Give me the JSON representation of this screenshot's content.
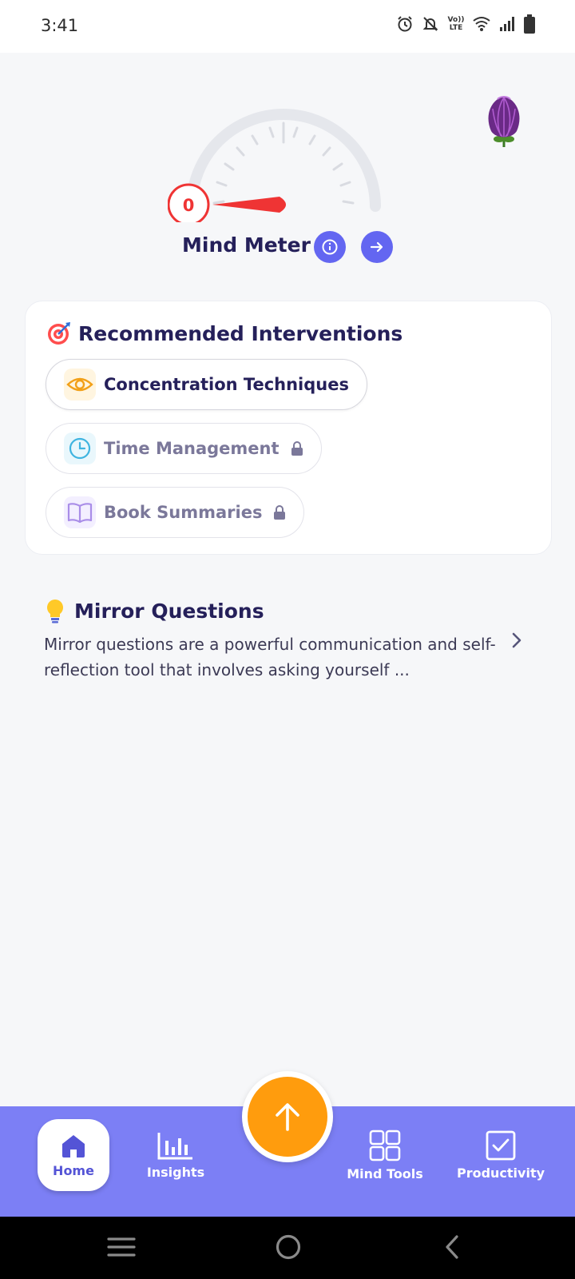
{
  "status_bar": {
    "time": "3:41",
    "icons": [
      "alarm-icon",
      "bell-muted-icon",
      "volte-icon",
      "wifi-icon",
      "signal-icon",
      "battery-icon"
    ],
    "volte_label": "Vo)) LTE"
  },
  "avatar": {
    "icon": "flower-avatar"
  },
  "mind_meter": {
    "value": "0",
    "label": "Mind Meter",
    "info_icon": "info-icon",
    "next_icon": "arrow-right-icon",
    "needle_color": "#ef3434"
  },
  "interventions": {
    "title": "Recommended Interventions",
    "title_icon": "target-icon",
    "items": [
      {
        "label": "Concentration Techniques",
        "icon": "eye-icon",
        "locked": false
      },
      {
        "label": "Time Management",
        "icon": "clock-icon",
        "locked": true
      },
      {
        "label": "Book Summaries",
        "icon": "book-icon",
        "locked": true
      }
    ]
  },
  "mirror_questions": {
    "title": "Mirror Questions",
    "title_icon": "lightbulb-icon",
    "description": "Mirror questions are a powerful communication and self-reflection tool that involves asking yourself ..."
  },
  "bottom_nav": {
    "items": [
      {
        "label": "Home",
        "icon": "home-icon",
        "selected": true
      },
      {
        "label": "Insights",
        "icon": "bar-chart-icon",
        "selected": false
      },
      {
        "label": "Mind Tools",
        "icon": "grid-icon",
        "selected": false
      },
      {
        "label": "Productivity",
        "icon": "checkbox-icon",
        "selected": false
      }
    ],
    "fab_icon": "arrow-up-icon"
  },
  "colors": {
    "accent": "#6366f1",
    "nav_background": "#7c7ff5",
    "fab": "#ff9c0d",
    "title_text": "#25205a"
  }
}
